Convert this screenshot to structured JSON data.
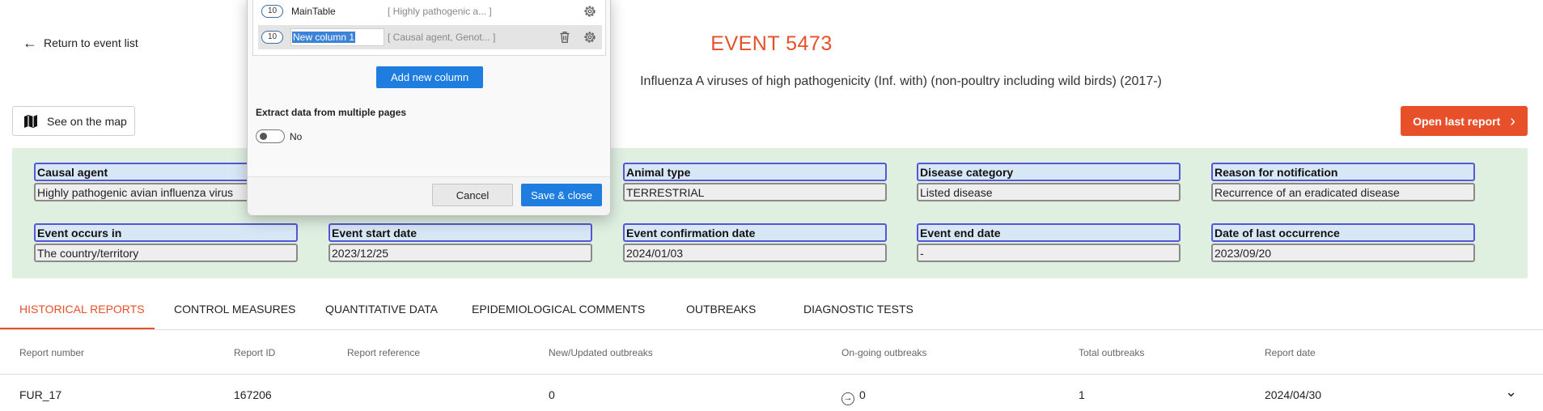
{
  "header": {
    "back_label": "Return to event list",
    "event_title": "EVENT 5473",
    "event_subtitle": "Influenza A viruses of high pathogenicity (Inf. with) (non-poultry including wild birds) (2017-)",
    "map_button": "See on the map",
    "open_report_button": "Open last report",
    "accent_color": "#e8502a"
  },
  "fields": [
    {
      "label": "Causal agent",
      "value": "Highly pathogenic avian influenza virus"
    },
    {
      "label": "Animal type",
      "value": "TERRESTRIAL"
    },
    {
      "label": "Disease category",
      "value": "Listed disease"
    },
    {
      "label": "Reason for notification",
      "value": "Recurrence of an eradicated disease"
    },
    {
      "label": "Event occurs in",
      "value": "The country/territory"
    },
    {
      "label": "Event start date",
      "value": "2023/12/25"
    },
    {
      "label": "Event confirmation date",
      "value": "2024/01/03"
    },
    {
      "label": "Event end date",
      "value": "-"
    },
    {
      "label": "Date of last occurrence",
      "value": "2023/09/20"
    }
  ],
  "tabs": [
    {
      "label": "HISTORICAL REPORTS",
      "active": true
    },
    {
      "label": "CONTROL MEASURES"
    },
    {
      "label": "QUANTITATIVE DATA"
    },
    {
      "label": "EPIDEMIOLOGICAL COMMENTS"
    },
    {
      "label": "OUTBREAKS"
    },
    {
      "label": "DIAGNOSTIC TESTS"
    }
  ],
  "table": {
    "columns": [
      "Report number",
      "Report ID",
      "Report reference",
      "New/Updated outbreaks",
      "On-going outbreaks",
      "Total outbreaks",
      "Report date"
    ],
    "rows": [
      {
        "report_number": "FUR_17",
        "report_id": "167206",
        "report_reference": "",
        "new_updated": "0",
        "ongoing": "0",
        "total": "1",
        "report_date": "2024/04/30"
      }
    ]
  },
  "dialog": {
    "columns": [
      {
        "count": "10",
        "name": "MainTable",
        "selector": "[ Highly pathogenic a... ]"
      },
      {
        "count": "10",
        "name": "New column 1",
        "selector": "[ Causal agent, Genot... ]"
      }
    ],
    "add_column_button": "Add new column",
    "extract_label": "Extract data from multiple pages",
    "toggle_label": "No",
    "cancel_button": "Cancel",
    "save_button": "Save & close",
    "primary_color": "#1f7de0"
  }
}
